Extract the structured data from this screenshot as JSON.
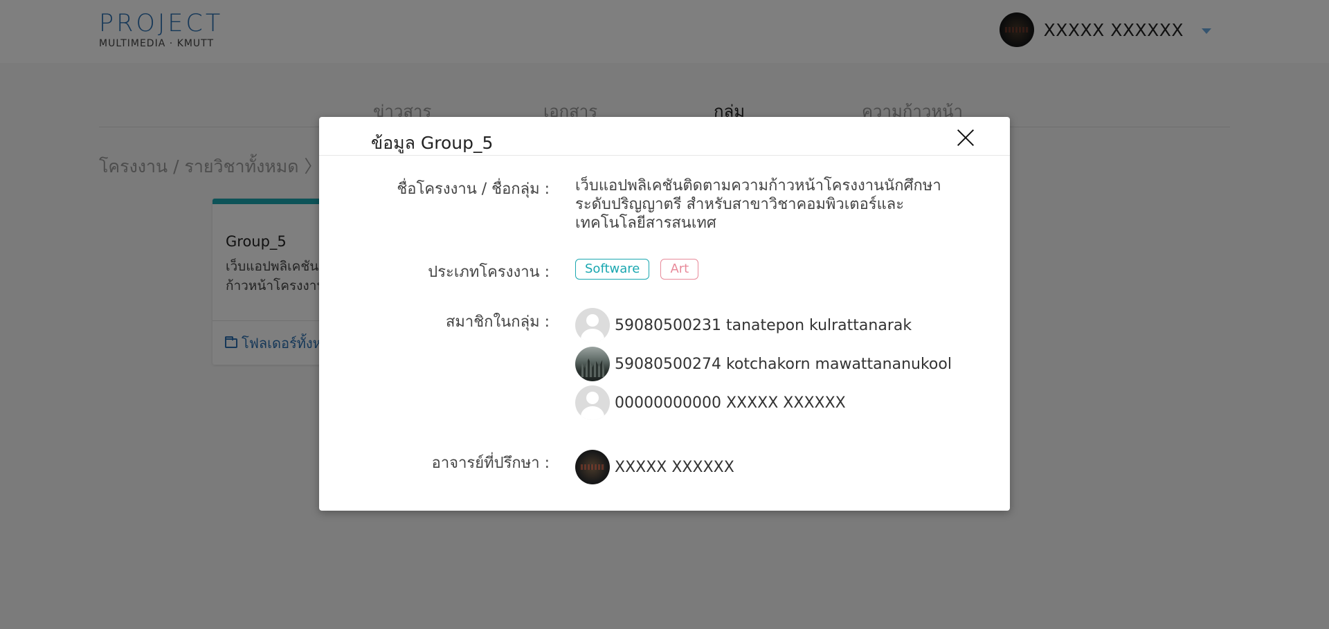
{
  "header": {
    "logo_title": "PROJECT",
    "logo_subtitle": "MULTIMEDIA · KMUTT",
    "user_name": "XXXXX XXXXXX"
  },
  "tabs": [
    {
      "label": "ข่าวสาร",
      "active": false
    },
    {
      "label": "เอกสาร",
      "active": false
    },
    {
      "label": "กลุ่ม",
      "active": true
    },
    {
      "label": "ความก้าวหน้า",
      "active": false
    }
  ],
  "breadcrumb": "โครงงาน / รายวิชาทั้งหมด 〉",
  "card": {
    "title": "Group_5",
    "description": "เว็บแอปพลิเคชัน\nก้าวหน้าโครงงาน",
    "folder_link": "โฟลเดอร์ทั้งห"
  },
  "modal": {
    "title": "ข้อมูล Group_5",
    "labels": {
      "project_name": "ชื่อโครงงาน / ชื่อกลุ่ม :",
      "project_type": "ประเภทโครงงาน :",
      "members": "สมาชิกในกลุ่ม :",
      "advisor": "อาจารย์ที่ปรึกษา :"
    },
    "project_name": "เว็บแอปพลิเคชันติดตามความก้าวหน้าโครงงานนักศึกษาระดับปริญญาตรี สำหรับสาขาวิชาคอมพิวเตอร์และเทคโนโลยีสารสนเทศ",
    "tags": [
      "Software",
      "Art"
    ],
    "members": [
      {
        "id_name": "59080500231 tanatepon kulrattanarak",
        "avatar": "default"
      },
      {
        "id_name": "59080500274 kotchakorn mawattananukool",
        "avatar": "photo"
      },
      {
        "id_name": "00000000000 XXXXX XXXXXX",
        "avatar": "default"
      }
    ],
    "advisor": "XXXXX XXXXXX"
  },
  "colors": {
    "brand_blue": "#2a6fb0",
    "teal": "#1aa7b0",
    "pink": "#e88a9a",
    "overlay": "rgba(0,0,0,0.5)"
  }
}
